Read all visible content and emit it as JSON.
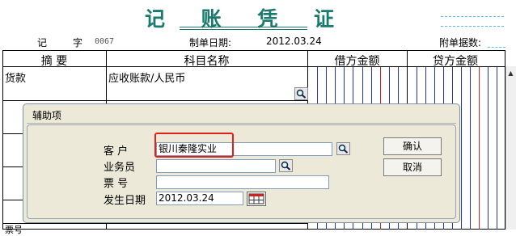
{
  "voucher": {
    "title": "记 账 凭 证",
    "type_label": "记",
    "type_char": "字",
    "number": "0067",
    "date_label": "制单日期:",
    "date_value": "2012.03.24",
    "attachments_label": "附单据数:"
  },
  "table": {
    "headers": [
      "摘 要",
      "科目名称",
      "借方金额",
      "贷方金额"
    ],
    "rows": [
      {
        "summary": "货款",
        "account": "应收账款/人民币"
      }
    ],
    "bottom_partial_text": "票号"
  },
  "dialog": {
    "title": "辅助项",
    "fields": [
      {
        "label": "客 户",
        "value": "银川秦隆实业"
      },
      {
        "label": "业务员",
        "value": ""
      },
      {
        "label": "票 号",
        "value": ""
      },
      {
        "label": "发生日期",
        "value": "2012.03.24"
      }
    ],
    "ok_label": "确认",
    "cancel_label": "取消"
  },
  "icons": {
    "lookup": "magnifier-icon",
    "calendar": "calendar-icon",
    "scroll_up": "scroll-up-arrow-icon"
  },
  "colors": {
    "title": "#1a7a6e",
    "highlight": "#e0201a",
    "money_grid_blue": "#2233cc",
    "money_grid_red": "#cc2222"
  }
}
